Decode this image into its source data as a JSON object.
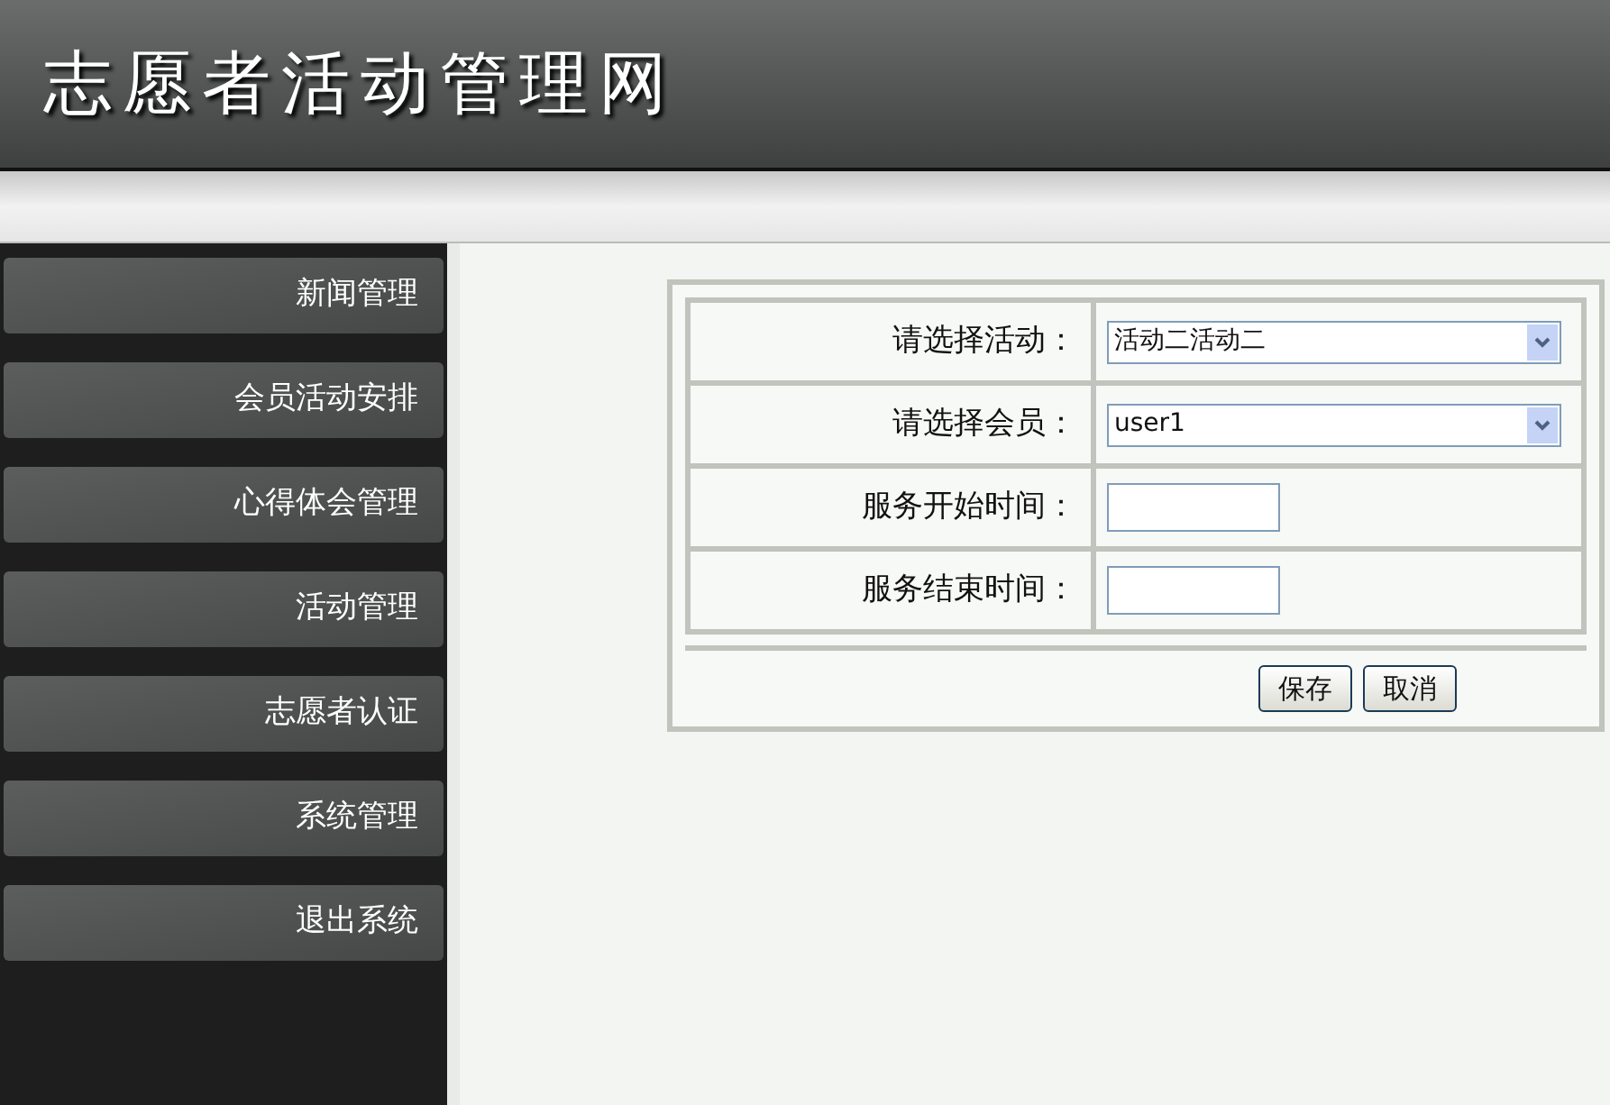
{
  "header": {
    "title": "志愿者活动管理网"
  },
  "sidebar": {
    "items": [
      {
        "label": "新闻管理"
      },
      {
        "label": "会员活动安排"
      },
      {
        "label": "心得体会管理"
      },
      {
        "label": "活动管理"
      },
      {
        "label": "志愿者认证"
      },
      {
        "label": "系统管理"
      },
      {
        "label": "退出系统"
      }
    ]
  },
  "form": {
    "fields": [
      {
        "kind": "select",
        "label": "请选择活动：",
        "value": "活动二活动二"
      },
      {
        "kind": "select",
        "label": "请选择会员：",
        "value": "user1"
      },
      {
        "kind": "text",
        "label": "服务开始时间："
      },
      {
        "kind": "text",
        "label": "服务结束时间："
      }
    ],
    "buttons": [
      "保存",
      "取消"
    ]
  }
}
